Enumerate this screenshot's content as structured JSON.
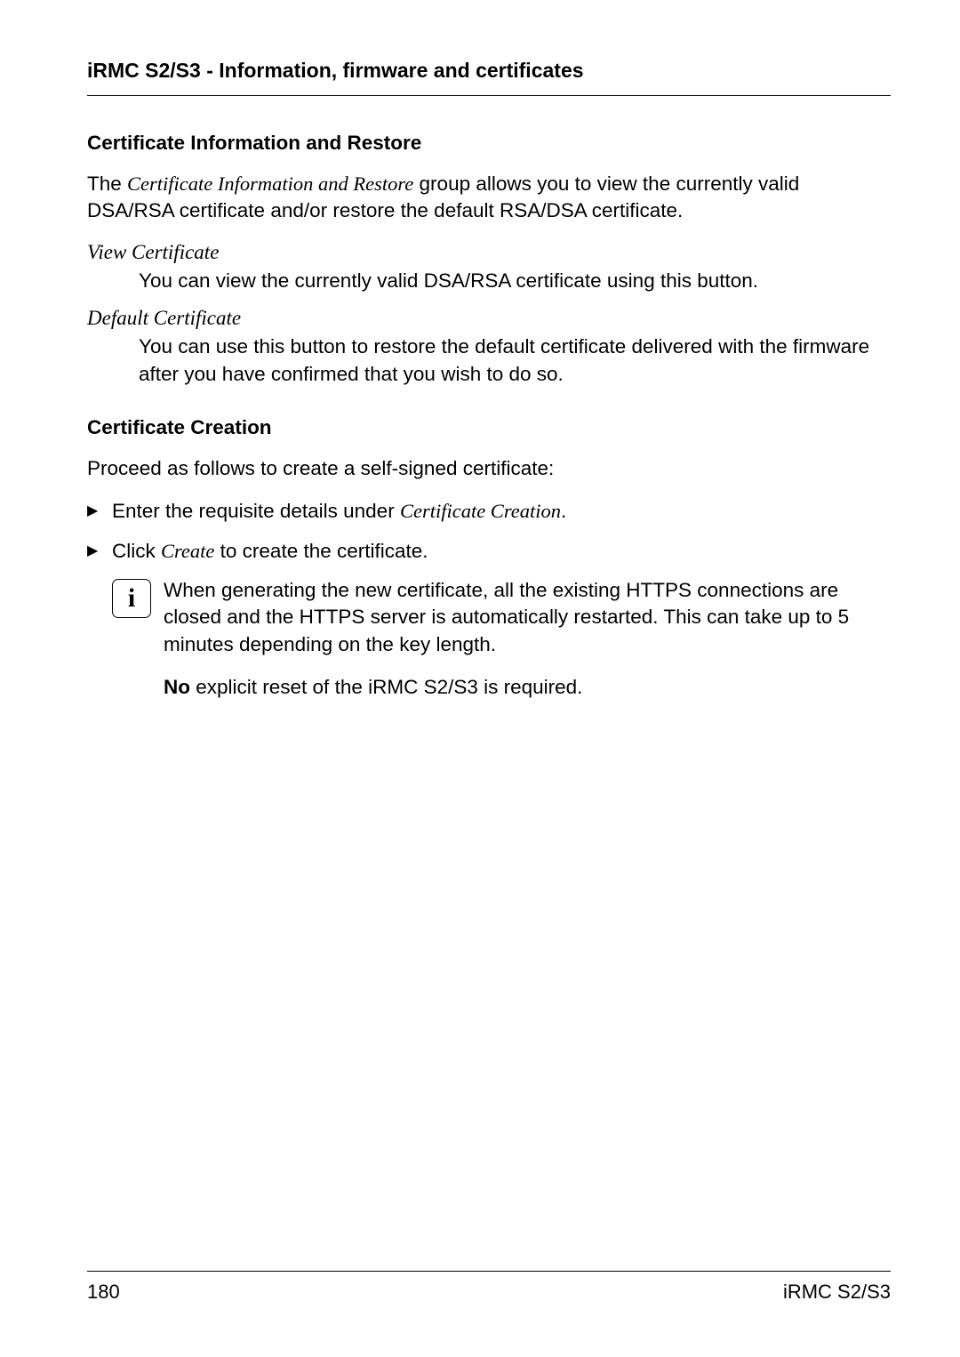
{
  "header": {
    "running_title": "iRMC S2/S3 - Information, firmware and certificates"
  },
  "section1": {
    "title": "Certificate Information and Restore",
    "intro_prefix": "The ",
    "intro_italic": "Certificate Information and Restore",
    "intro_suffix": " group allows you to view the currently valid DSA/RSA certificate and/or restore the default RSA/DSA certificate.",
    "items": [
      {
        "term": "View Certificate",
        "desc": "You can view the currently valid DSA/RSA certificate using this button."
      },
      {
        "term": "Default Certificate",
        "desc": "You can use this button to restore the default certificate delivered with the firmware after you have confirmed that you wish to do so."
      }
    ]
  },
  "section2": {
    "title": "Certificate Creation",
    "intro": "Proceed as follows to create a self-signed certificate:",
    "steps": [
      {
        "prefix": "Enter the requisite details under ",
        "italic": "Certificate Creation",
        "suffix": "."
      },
      {
        "prefix": "Click ",
        "italic": "Create",
        "suffix": " to create the certificate."
      }
    ],
    "note": {
      "icon_label": "i",
      "para1": "When generating the new certificate, all the existing HTTPS connections are closed and the HTTPS server is automatically restarted. This can take up to 5 minutes depending on the key length.",
      "para2_bold": "No",
      "para2_rest": " explicit reset of the iRMC S2/S3 is required."
    }
  },
  "footer": {
    "page_number": "180",
    "doc_label": "iRMC S2/S3"
  },
  "markers": {
    "triangle": "▶"
  }
}
